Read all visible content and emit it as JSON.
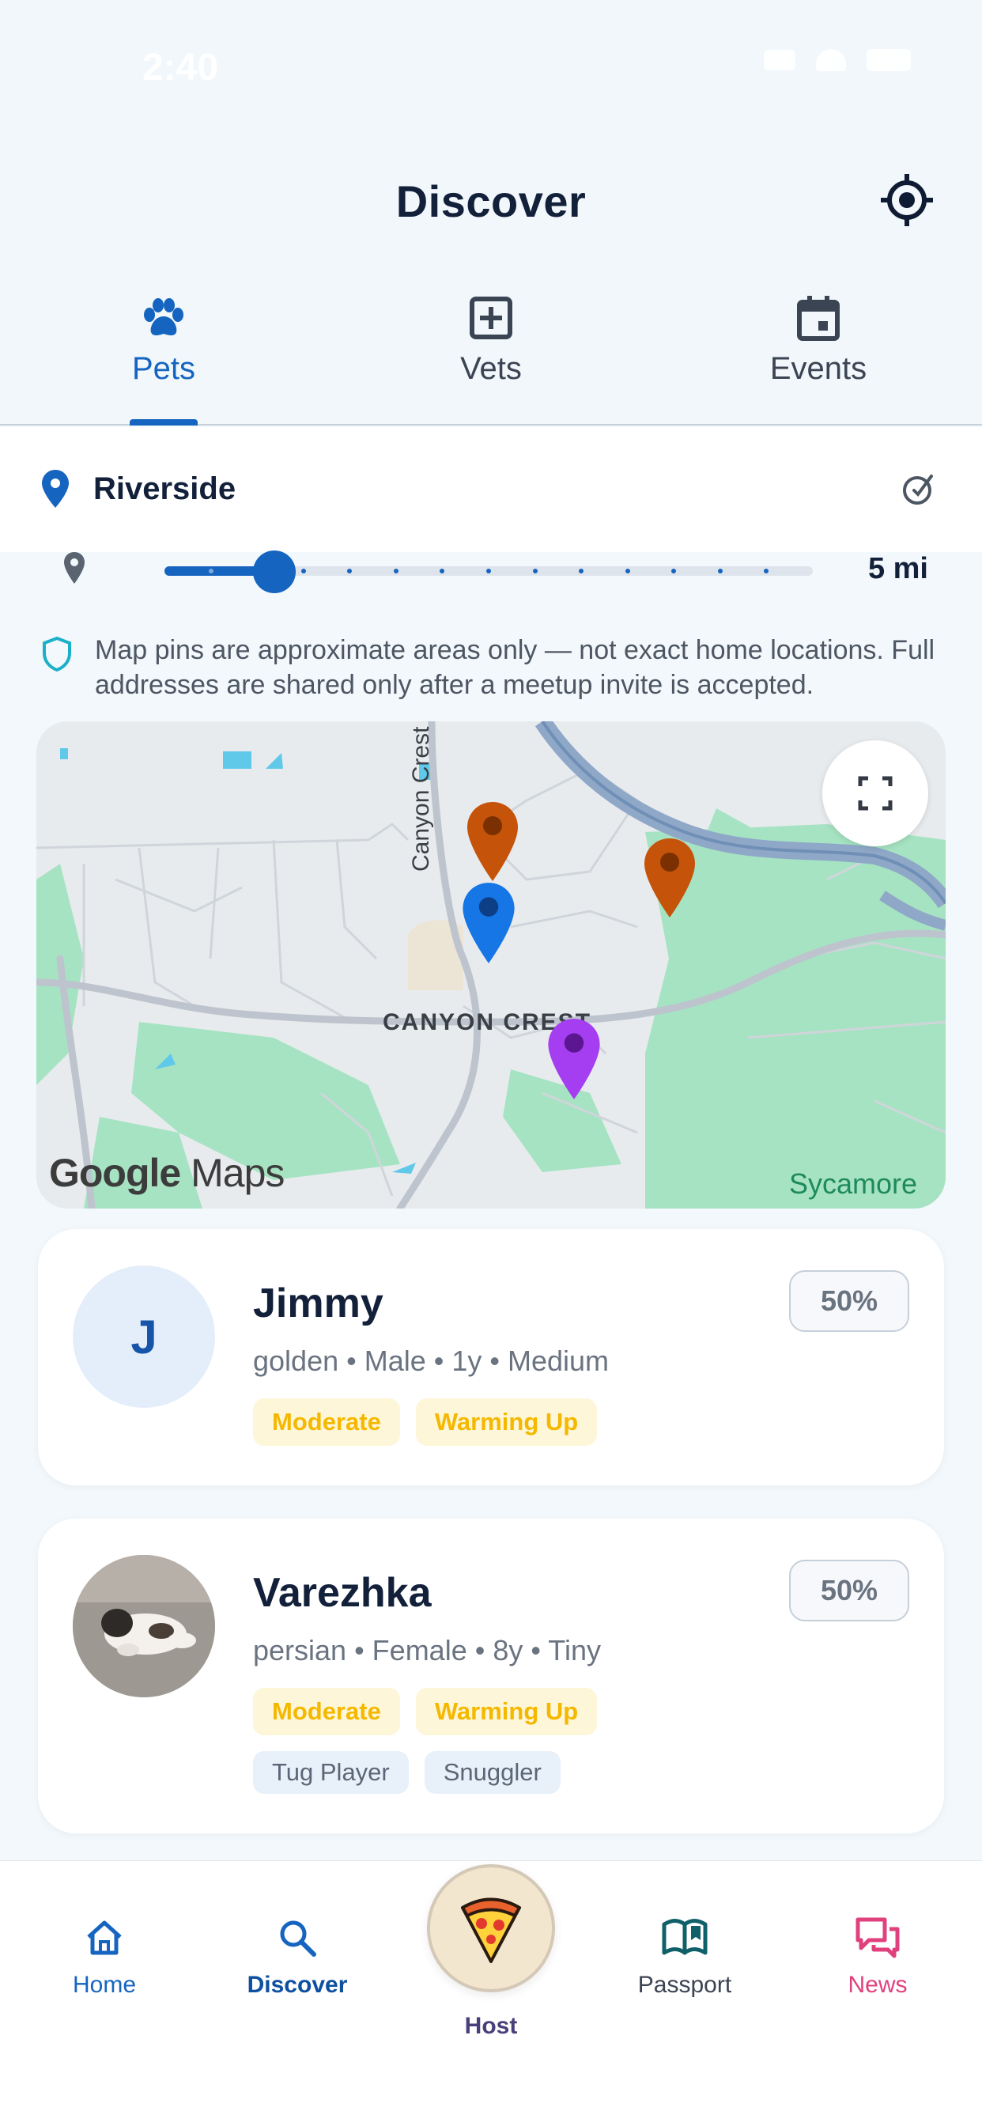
{
  "status_bar": {
    "time": "2:40"
  },
  "header": {
    "title": "Discover"
  },
  "tabs": [
    {
      "label": "Pets",
      "icon": "paw-icon",
      "active": true
    },
    {
      "label": "Vets",
      "icon": "medical-plus-icon",
      "active": false
    },
    {
      "label": "Events",
      "icon": "calendar-icon",
      "active": false
    }
  ],
  "location": {
    "name": "Riverside"
  },
  "radius": {
    "value_label": "5 mi",
    "fraction": 0.17
  },
  "privacy_note": "Map pins are approximate areas only — not exact home locations. Full addresses are shared only after a meetup invite is accepted.",
  "map": {
    "logo_google": "Google",
    "logo_maps": "Maps",
    "area_label": "CANYON CREST",
    "street_label": "Canyon Crest",
    "corner_label": "Sycamore",
    "pin_colors": {
      "orange": "#c5540a",
      "blue": "#1676e6",
      "purple": "#a43ef0"
    }
  },
  "pets": [
    {
      "initial": "J",
      "name": "Jimmy",
      "details": "golden • Male • 1y • Medium",
      "match": "50%",
      "tags": [
        "Moderate",
        "Warming Up"
      ],
      "traits": []
    },
    {
      "initial": "",
      "name": "Varezhka",
      "details": "persian • Female • 8y • Tiny",
      "match": "50%",
      "tags": [
        "Moderate",
        "Warming Up"
      ],
      "traits": [
        "Tug Player",
        "Snuggler"
      ]
    }
  ],
  "nav": {
    "home": "Home",
    "discover": "Discover",
    "host": "Host",
    "passport": "Passport",
    "news": "News"
  },
  "colors": {
    "primary": "#1565c0",
    "news_pink": "#e0417d",
    "passport_teal": "#10606a"
  }
}
